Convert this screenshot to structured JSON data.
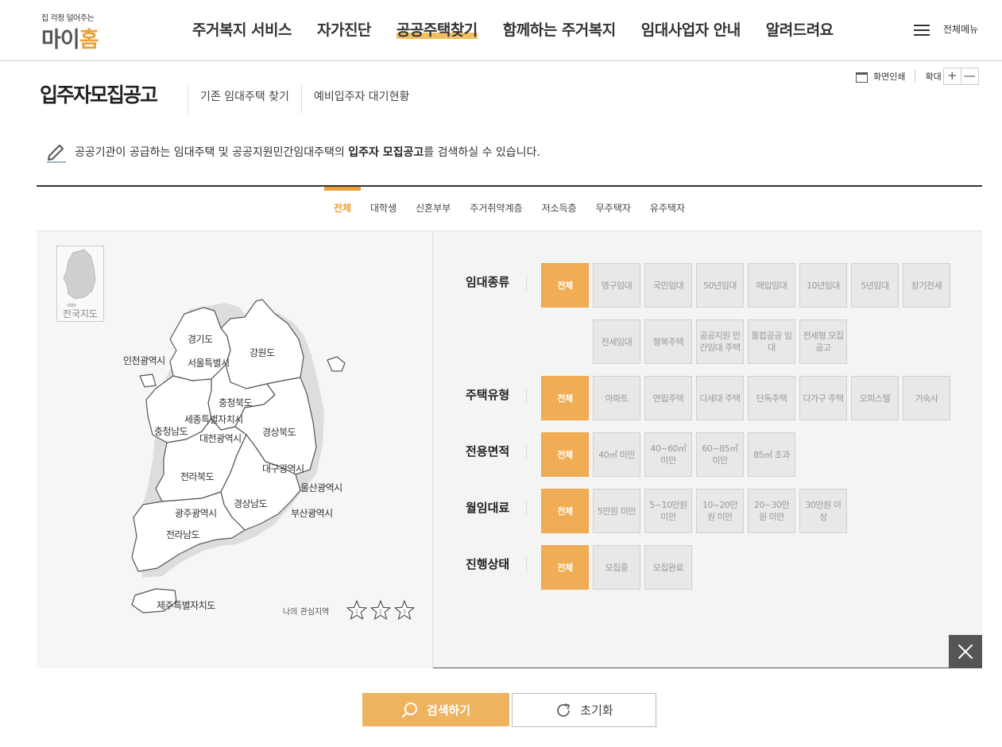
{
  "header": {
    "logo_tagline": "집 걱정 덜어주는",
    "logo_name_a": "마이",
    "logo_name_b": "홈",
    "nav": [
      "주거복지 서비스",
      "자가진단",
      "공공주택찾기",
      "함께하는 주거복지",
      "임대사업자 안내",
      "알려드려요"
    ],
    "active_nav": "공공주택찾기",
    "all_menu": "전체메뉴"
  },
  "title_bar": {
    "title": "입주자모집공고",
    "tabs": [
      "기존 임대주택 찾기",
      "예비입주자 대기현황"
    ],
    "print": "화면인쇄",
    "zoom": "확대",
    "zoom_in": "+",
    "zoom_out": "—"
  },
  "description": {
    "before": "공공기관이 공급하는 임대주택 및 공공지원민간임대주택의 ",
    "bold": "입주자 모집공고",
    "after": "를 검색하실 수 있습니다."
  },
  "category_tabs": [
    "전체",
    "대학생",
    "신혼부부",
    "주거취약계층",
    "저소득층",
    "무주택자",
    "유주택자"
  ],
  "map": {
    "national_map": "전국지도",
    "regions": [
      "경기도",
      "강원도",
      "인천광역시",
      "서울특별시",
      "충청북도",
      "세종특별자치시",
      "충청남도",
      "대전광역시",
      "경상북도",
      "대구광역시",
      "전라북도",
      "울산광역시",
      "경상남도",
      "광주광역시",
      "부산광역시",
      "전라남도",
      "제주특별자치도"
    ],
    "favorites_label": "나의 관심지역",
    "favorite_slots": [
      "1",
      "2",
      "3"
    ]
  },
  "options": {
    "rental_type": {
      "label": "임대종류",
      "items": [
        "전체",
        "영구임대",
        "국민임대",
        "50년임대",
        "매입임대",
        "10년임대",
        "5년임대",
        "장기전세",
        "전세임대",
        "행복주택",
        "공공지원 민간임대 주택",
        "통합공공 임대",
        "전세형 모집공고"
      ]
    },
    "housing_type": {
      "label": "주택유형",
      "items": [
        "전체",
        "아파트",
        "연립주택",
        "다세대 주택",
        "단독주택",
        "다가구 주택",
        "오피스텔",
        "기숙사"
      ]
    },
    "area": {
      "label": "전용면적",
      "items": [
        "전체",
        "40㎡ 미만",
        "40~60㎡ 미만",
        "60~85㎡ 미만",
        "85㎡ 초과"
      ]
    },
    "rent": {
      "label": "월임대료",
      "items": [
        "전체",
        "5만원 미만",
        "5~10만원 미만",
        "10~20만원 미만",
        "20~30만원 미만",
        "30만원 이상"
      ]
    },
    "status": {
      "label": "진행상태",
      "items": [
        "전체",
        "모집중",
        "모집완료"
      ]
    }
  },
  "actions": {
    "search": "검색하기",
    "reset": "초기화"
  },
  "colors": {
    "accent": "#f0ad55",
    "logo_orange": "#e9a23b"
  }
}
